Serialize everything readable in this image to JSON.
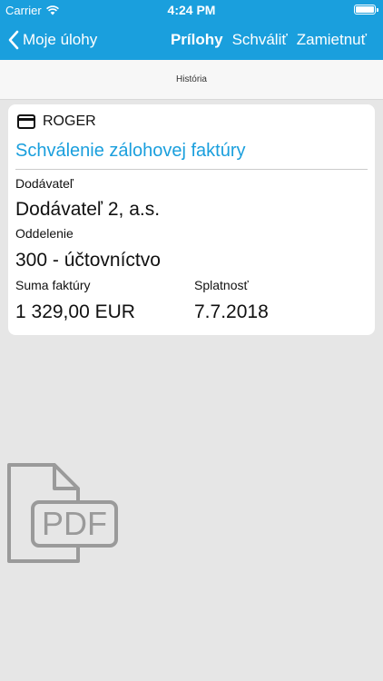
{
  "status_bar": {
    "carrier": "Carrier",
    "time": "4:24 PM"
  },
  "nav": {
    "back_label": "Moje úlohy",
    "attachments_label": "Prílohy",
    "approve_label": "Schváliť",
    "reject_label": "Zamietnuť"
  },
  "segment": {
    "history_label": "História"
  },
  "card": {
    "user": "ROGER",
    "title": "Schválenie zálohovej faktúry",
    "supplier_label": "Dodávateľ",
    "supplier_value": "Dodávateľ 2, a.s.",
    "department_label": "Oddelenie",
    "department_value": "300 - účtovníctvo",
    "amount_label": "Suma faktúry",
    "amount_value": "1 329,00 EUR",
    "due_label": "Splatnosť",
    "due_value": "7.7.2018"
  },
  "attachment": {
    "icon": "pdf-file-icon",
    "text": "PDF"
  },
  "colors": {
    "accent": "#1a9fdd",
    "background": "#e6e6e6",
    "icon_gray": "#9a9a9a"
  }
}
